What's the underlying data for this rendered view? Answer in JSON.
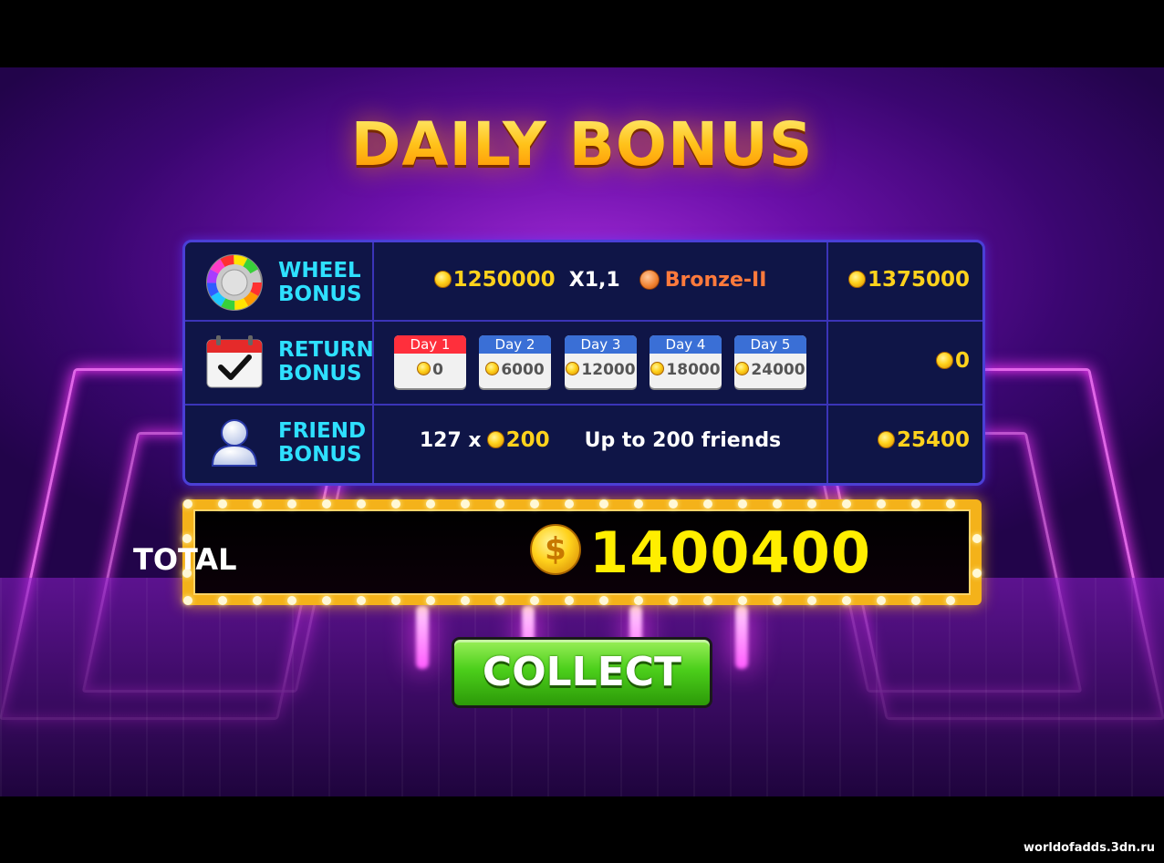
{
  "title": "DAILY BONUS",
  "rows": {
    "wheel": {
      "label_line1": "WHEEL",
      "label_line2": "BONUS",
      "amount": "1250000",
      "multiplier": "X1,1",
      "tier": "Bronze-II",
      "result": "1375000"
    },
    "return": {
      "label_line1": "RETURN",
      "label_line2": "BONUS",
      "days": [
        {
          "label": "Day 1",
          "value": "0"
        },
        {
          "label": "Day 2",
          "value": "6000"
        },
        {
          "label": "Day 3",
          "value": "12000"
        },
        {
          "label": "Day 4",
          "value": "18000"
        },
        {
          "label": "Day 5",
          "value": "24000"
        }
      ],
      "result": "0"
    },
    "friend": {
      "label_line1": "FRIEND",
      "label_line2": "BONUS",
      "count_text": "127 x",
      "per_friend": "200",
      "limit_text": "Up to 200 friends",
      "result": "25400"
    }
  },
  "total": {
    "label": "TOTAL",
    "value": "1400400",
    "coin_symbol": "$"
  },
  "collect_label": "COLLECT",
  "watermark": "worldofadds.3dn.ru",
  "colors": {
    "title_gold": "#ffc21a",
    "label_cyan": "#2ee0ff",
    "coin_gold": "#ffd21c",
    "bronze": "#ff7a3c",
    "day1_header": "#ff2f3c",
    "day_header": "#3a6fd6",
    "collect_green": "#4ccf1b"
  },
  "icons": [
    "prize-wheel-icon",
    "calendar-check-icon",
    "user-icon",
    "coin-icon"
  ]
}
